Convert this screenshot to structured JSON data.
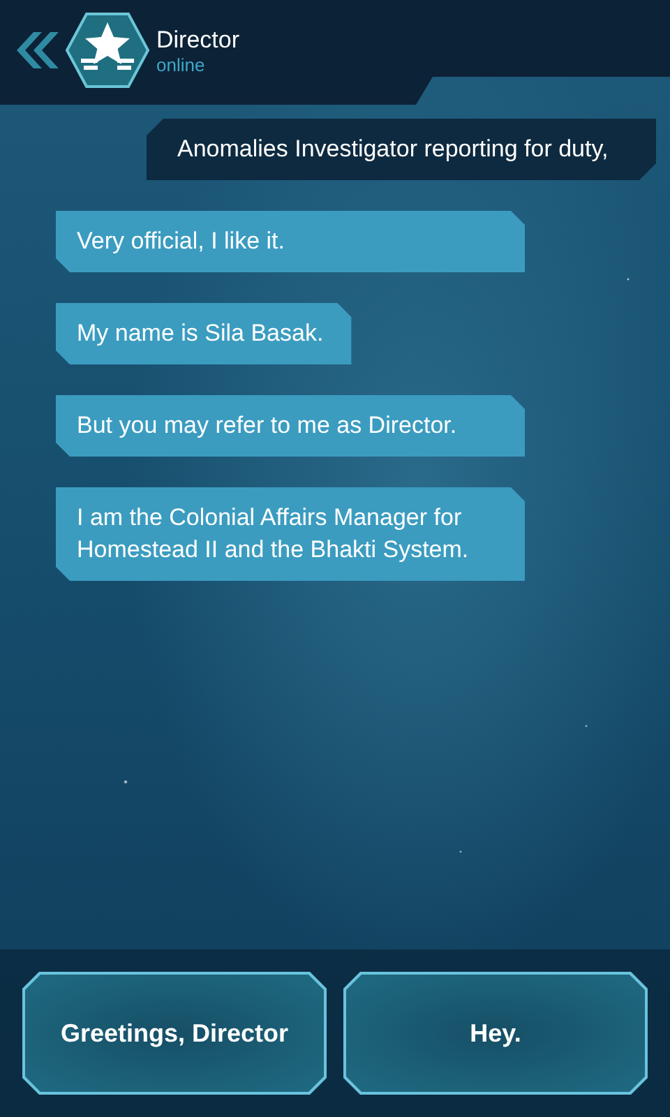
{
  "header": {
    "title": "Director",
    "status": "online"
  },
  "messages": [
    {
      "kind": "sent",
      "text": "Anomalies Investigator reporting for duty,"
    },
    {
      "kind": "received",
      "text": "Very official, I like it."
    },
    {
      "kind": "received",
      "text": "My name is Sila Basak."
    },
    {
      "kind": "received",
      "text": "But you may refer to me as Director."
    },
    {
      "kind": "received",
      "text": "I am the Colonial Affairs Manager for Homestead II and the Bhakti System."
    }
  ],
  "replies": [
    "Greetings, Director",
    "Hey."
  ]
}
